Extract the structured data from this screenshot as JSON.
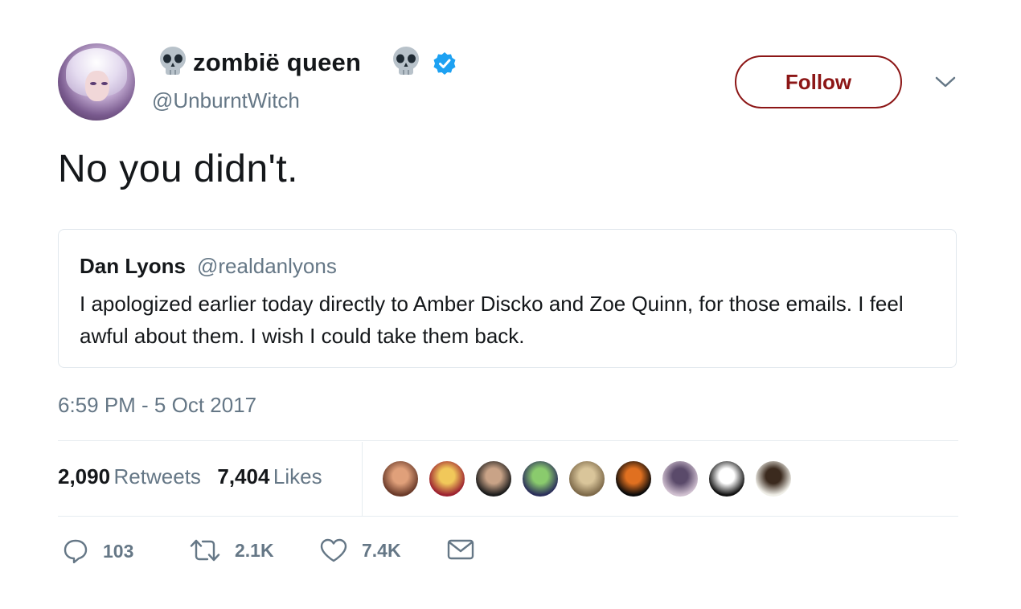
{
  "author": {
    "display_name": "zombië queen",
    "handle": "@UnburntWitch",
    "verified": true,
    "name_emoji": "skull-emoji"
  },
  "follow_button": {
    "label": "Follow",
    "color": "#8c1616"
  },
  "tweet": {
    "text": "No you didn't.",
    "timestamp": "6:59 PM - 5 Oct 2017"
  },
  "quoted_tweet": {
    "name": "Dan Lyons",
    "handle": "@realdanlyons",
    "text": "I apologized earlier today directly to Amber Discko and Zoe Quinn, for those emails. I feel awful about them. I wish I could take them back."
  },
  "stats": {
    "retweets_count": "2,090",
    "retweets_label": "Retweets",
    "likes_count": "7,404",
    "likes_label": "Likes"
  },
  "liked_by_avatars": [
    {
      "color_a": "#6b3b2a",
      "color_b": "#e0a07a"
    },
    {
      "color_a": "#9c2230",
      "color_b": "#f1c85a"
    },
    {
      "color_a": "#1c1c1c",
      "color_b": "#c9a387"
    },
    {
      "color_a": "#2b2f5a",
      "color_b": "#8acb6d"
    },
    {
      "color_a": "#7e6a4a",
      "color_b": "#d9c59a"
    },
    {
      "color_a": "#0a0a0a",
      "color_b": "#e07020"
    },
    {
      "color_a": "#cfbfcf",
      "color_b": "#5a4a6a"
    },
    {
      "color_a": "#111111",
      "color_b": "#ffffff"
    },
    {
      "color_a": "#f0efe8",
      "color_b": "#3b2a1e"
    }
  ],
  "actions": {
    "reply_count": "103",
    "retweet_count": "2.1K",
    "like_count": "7.4K"
  },
  "colors": {
    "text_primary": "#14171a",
    "text_secondary": "#657786",
    "border": "#e6ecf0",
    "verified_blue": "#1da1f2"
  }
}
